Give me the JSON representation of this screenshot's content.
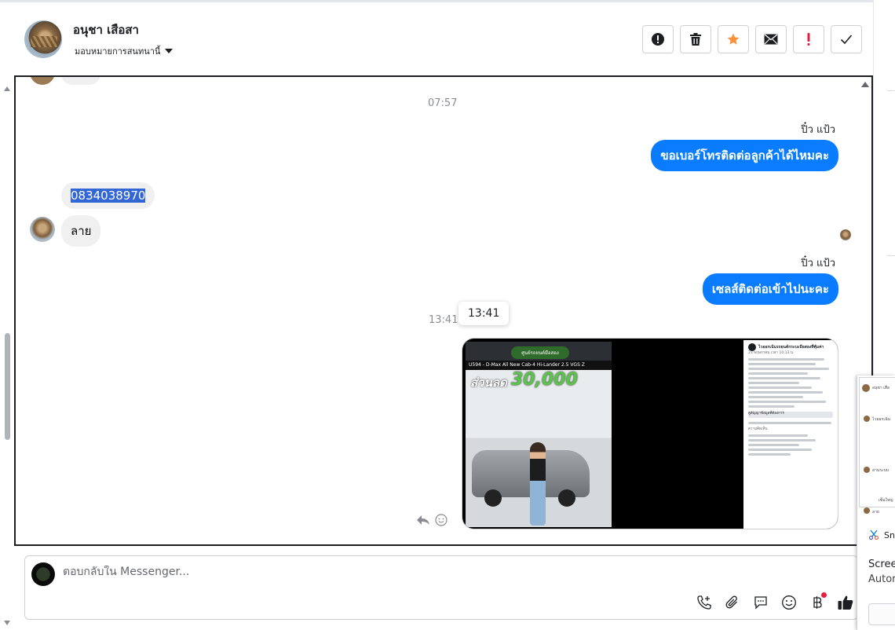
{
  "header": {
    "contact_name": "อนุชา เสือสา",
    "assign_label": "มอบหมายการสนทนานี้",
    "actions": [
      "report-spam",
      "delete",
      "star",
      "mark-unread",
      "important",
      "done"
    ]
  },
  "conversation": {
    "timestamps": [
      "07:57",
      "13:41"
    ],
    "messages": [
      {
        "sender": "ปิ๋ว แป้ว",
        "text": "ขอเบอร์โทรติดต่อลูกค้าได้ไหมคะ",
        "direction": "out"
      },
      {
        "text": "0834038970",
        "direction": "in"
      },
      {
        "text": "ลาย",
        "direction": "in"
      },
      {
        "sender": "ปิ๋ว แป้ว",
        "text": "เซลส์ติดต่อเข้าไปนะคะ",
        "direction": "out"
      }
    ],
    "tooltip": "13:41",
    "attachment": {
      "video_logo": "ศูนย์รถยนต์มือสอง",
      "video_banner": "U594 - D-Max All New Cab-4 Hi-Lander 2.5 VGS Z",
      "discount_label": "ส่วนลด",
      "discount_amount": "30,000",
      "panel_title": "ไวออกเน้นรถยนต์กระบะมือสองที่คุ้มค่า",
      "panel_date": "23 พฤษภาคม เวลา 10:13 น.",
      "panel_cta": "ดูสัญญาข้อมูลที่ต้องการ",
      "panel_comments_label": "ความคิดเห็น"
    }
  },
  "composer": {
    "placeholder": "ตอบกลับใน Messenger...",
    "tools": [
      "add-call-icon",
      "attach-icon",
      "saved-replies-icon",
      "emoji-icon",
      "payment-icon",
      "like-icon"
    ]
  },
  "overlay": {
    "app_name": "Sn",
    "title": "Scree",
    "subtitle": "Autor",
    "thumb_lines": [
      "อนุชา เสือ",
      "ไวออกเน้น",
      "อ่านระบบ",
      "เซ็นใหญ่",
      "ลาย"
    ]
  },
  "colors": {
    "brand_blue": "#0a7cff",
    "star_orange": "#f7923b",
    "important_red": "#e41e3f",
    "selection": "#3367d6"
  }
}
